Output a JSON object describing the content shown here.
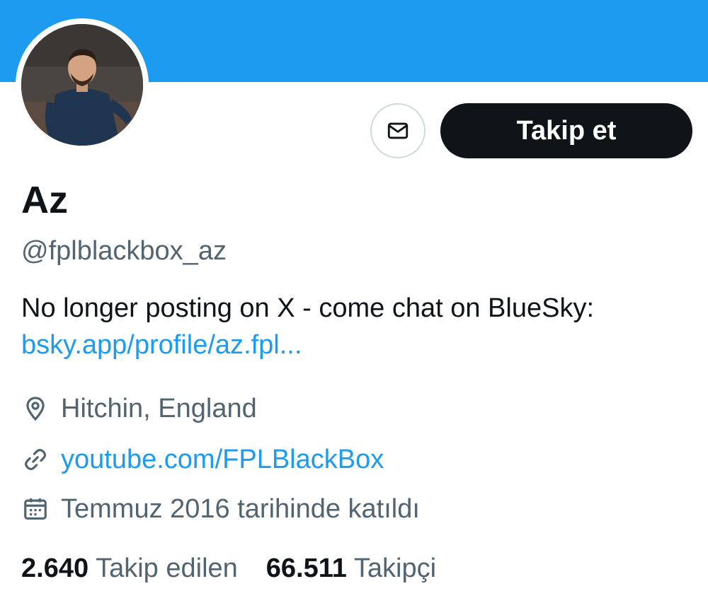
{
  "profile": {
    "name": "Az",
    "handle": "@fplblackbox_az",
    "bio_text": "No longer posting on X - come chat on BlueSky:",
    "bio_link": "bsky.app/profile/az.fpl...",
    "location": "Hitchin, England",
    "website": "youtube.com/FPLBlackBox",
    "joined": "Temmuz 2016 tarihinde katıldı"
  },
  "actions": {
    "follow_label": "Takip et"
  },
  "stats": {
    "following_count": "2.640",
    "following_label": "Takip edilen",
    "followers_count": "66.511",
    "followers_label": "Takipçi"
  },
  "icons": {
    "message": "envelope-icon",
    "location": "map-pin-icon",
    "website": "link-icon",
    "joined": "calendar-icon"
  },
  "colors": {
    "banner": "#1d9bf0",
    "link": "#1d9bf0",
    "primary_text": "#0f1419",
    "secondary_text": "#536471",
    "follow_button_bg": "#0f1419"
  }
}
